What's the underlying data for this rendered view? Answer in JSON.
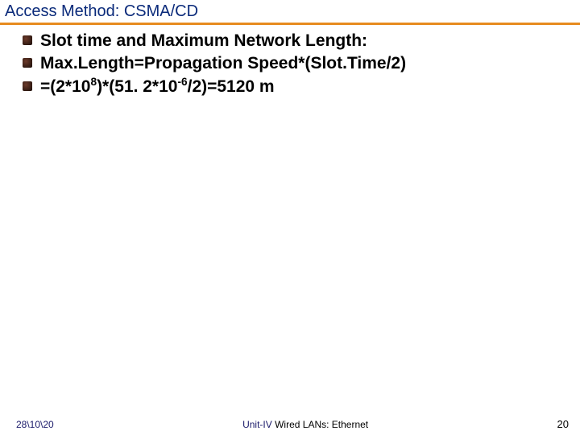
{
  "header": {
    "title": "Access Method: CSMA/CD"
  },
  "bullets": [
    {
      "html": "Slot time and Maximum Network Length:"
    },
    {
      "html": "Max.Length=Propagation Speed*(Slot.Time/2)"
    },
    {
      "html": "=(2*10<sup>8</sup>)*(51. 2*10<sup>-6</sup>/2)=5120 m"
    }
  ],
  "footer": {
    "date": "28\\10\\20",
    "unit_label": "Unit-IV",
    "center_rest": " Wired LANs: Ethernet",
    "page_number": "20"
  }
}
